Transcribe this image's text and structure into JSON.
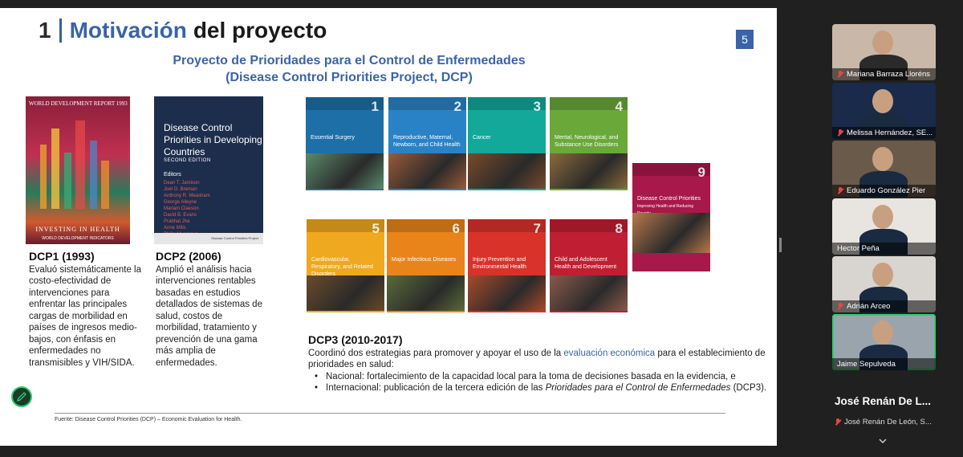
{
  "slide": {
    "title_num": "1",
    "title_highlight": "Motivación",
    "title_rest": "del proyecto",
    "page": "5",
    "subtitle_line1": "Proyecto de Prioridades para el Control de Enfermedades",
    "subtitle_line2": "(Disease Control Priorities Project, DCP)",
    "wdr_cover": {
      "head": "WORLD DEVELOPMENT REPORT 1993",
      "foot": "INVESTING IN HEALTH",
      "foot2": "WORLD DEVELOPMENT INDICATORS"
    },
    "dcp2_cover": {
      "title": "Disease Control Priorities in Developing Countries",
      "edition": "SECOND EDITION",
      "editors_label": "Editors",
      "names": [
        "Dean T. Jamison",
        "Joel G. Breman",
        "Anthony R. Measham",
        "George Alleyne",
        "Mariam Claeson",
        "David B. Evans",
        "Prabhat Jha",
        "Anne Mills",
        "Philip Musgrove"
      ],
      "publisher": "Disease Control Priorities Project"
    },
    "dcp3_covers": [
      {
        "n": "1",
        "title": "Essential Surgery",
        "color": "#1d6fa8",
        "photo": "#5b8a6a"
      },
      {
        "n": "2",
        "title": "Reproductive, Maternal, Newborn, and Child Health",
        "color": "#2a82c6",
        "photo": "#9a5a3a"
      },
      {
        "n": "3",
        "title": "Cancer",
        "color": "#12a89a",
        "photo": "#7a4a2a"
      },
      {
        "n": "4",
        "title": "Mental, Neurological, and Substance Use Disorders",
        "color": "#6aa83a",
        "photo": "#8a6a3a"
      },
      {
        "n": "5",
        "title": "Cardiovascular, Respiratory, and Related Disorders",
        "color": "#f0a81e",
        "photo": "#6a4a2a"
      },
      {
        "n": "6",
        "title": "Major Infectious Diseases",
        "color": "#e8841a",
        "photo": "#5a6a3a"
      },
      {
        "n": "7",
        "title": "Injury Prevention and Environmental Health",
        "color": "#d8322a",
        "photo": "#a84a2a"
      },
      {
        "n": "8",
        "title": "Child and Adolescent Health and Development",
        "color": "#c01e32",
        "photo": "#8a5a4a"
      },
      {
        "n": "9",
        "title": "Disease Control Priorities",
        "sub": "Improving Health and Reducing Poverty",
        "color": "#a8184a",
        "photo": "#b8784a"
      }
    ],
    "dcp1": {
      "heading": "DCP1 (1993)",
      "text": "Evaluó sistemáticamente la costo-efectividad de intervenciones para enfrentar las principales cargas de morbilidad en países de ingresos medio-bajos, con énfasis en enfermedades no transmisibles y VIH/SIDA."
    },
    "dcp2": {
      "heading": "DCP2 (2006)",
      "text": "Amplió el análisis hacia intervenciones rentables basadas en estudios detallados de sistemas de salud, costos de morbilidad, tratamiento y prevención de una gama más amplia de enfermedades."
    },
    "dcp3": {
      "heading": "DCP3 (2010-2017)",
      "intro_before": "Coordinó dos estrategias para promover y apoyar el uso de la ",
      "intro_link": "evaluación económica",
      "intro_after": " para el establecimiento de prioridades en salud:",
      "bullet1": "Nacional: fortalecimiento de la capacidad local para la toma de decisiones basada en la evidencia, e",
      "bullet2_before": "Internacional: publicación de la tercera edición de las ",
      "bullet2_italic": "Prioridades para el Control de Enfermedades",
      "bullet2_after": " (DCP3)."
    },
    "source": "Fuente: Disease Control Priorities (DCP) – Economic Evaluation for Health."
  },
  "participants": [
    {
      "name": "Mariana Barraza Lloréns",
      "muted": true,
      "bg": "#c9b8a8"
    },
    {
      "name": "Melissa Hernández, SE...",
      "muted": true,
      "bg": "#1a2a4a"
    },
    {
      "name": "Eduardo González Pier",
      "muted": true,
      "bg": "#6a5a4a"
    },
    {
      "name": "Hector Peña",
      "muted": false,
      "bg": "#e8e4e0"
    },
    {
      "name": "Adrián Arceo",
      "muted": true,
      "bg": "#d8d4d0"
    },
    {
      "name": "Jaime Sepulveda",
      "muted": false,
      "bg": "#9aa4ac",
      "active": true
    }
  ],
  "featured": {
    "name_big": "José Renán De L...",
    "name_small": "José Renán De León, S..."
  }
}
